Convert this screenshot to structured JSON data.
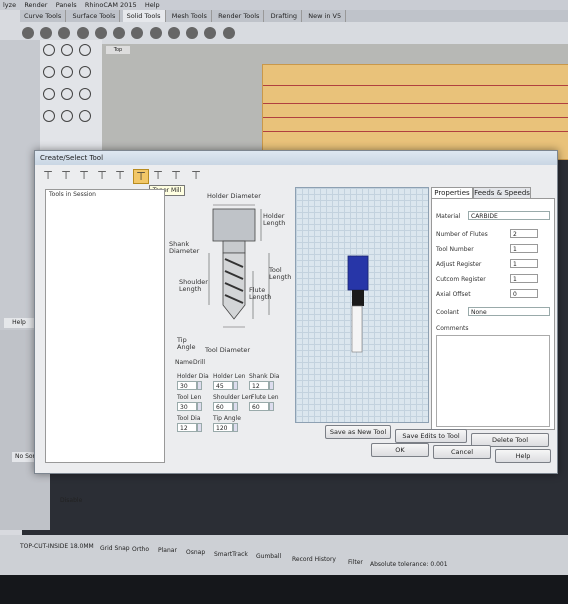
{
  "app": {
    "menu": [
      "lyze",
      "Render",
      "Panels",
      "RhinoCAM 2015",
      "Help"
    ],
    "tabs": [
      "Curve Tools",
      "Surface Tools",
      "Solid Tools",
      "Mesh Tools",
      "Render Tools",
      "Drafting",
      "New in V5"
    ],
    "active_tab": "Solid Tools",
    "help_label": "Help",
    "no_sort_label": "No Sort",
    "viewport_label": "Top"
  },
  "statusbar": {
    "layer": "TOP-CUT-INSIDE",
    "layer_value": "18.0MM",
    "grid_snap": "Grid Snap",
    "ortho": "Ortho",
    "planar": "Planar",
    "osnap": "Osnap",
    "smarttrack": "SmartTrack",
    "gumball": "Gumball",
    "record_history": "Record History",
    "filter": "Filter",
    "tolerance": "Absolute tolerance: 0.001",
    "disable": "Disable"
  },
  "dialog": {
    "title": "Create/Select Tool",
    "tooltip": "Taper Mill",
    "tools_in_session": "Tools in Session",
    "drawing": {
      "holder_diameter": "Holder Diameter",
      "holder_length": "Holder Length",
      "shank_diameter": "Shank Diameter",
      "tool_length": "Tool Length",
      "shoulder_length": "Shoulder Length",
      "flute_length": "Flute Length",
      "tip_angle": "Tip Angle",
      "tool_diameter": "Tool Diameter"
    },
    "name_label": "Name",
    "name_value": "Drill",
    "dims": {
      "holder_dia_label": "Holder Dia",
      "holder_dia": "30",
      "holder_len_label": "Holder Len",
      "holder_len": "45",
      "shank_dia_label": "Shank Dia",
      "shank_dia": "12",
      "tool_len_label": "Tool Len",
      "tool_len": "30",
      "shoulder_len_label": "Shoulder Len",
      "shoulder_len": "60",
      "flute_len_label": "Flute Len",
      "flute_len": "60",
      "tool_dia_label": "Tool Dia",
      "tool_dia": "12",
      "tip_angle_label": "Tip Angle",
      "tip_angle": "120"
    },
    "properties": {
      "tab_properties": "Properties",
      "tab_feeds": "Feeds & Speeds",
      "material_label": "Material",
      "material_value": "CARBIDE",
      "flutes_label": "Number of Flutes",
      "flutes_value": "2",
      "tool_number_label": "Tool Number",
      "tool_number_value": "1",
      "adjust_register_label": "Adjust Register",
      "adjust_register_value": "1",
      "cutcom_register_label": "Cutcom Register",
      "cutcom_register_value": "1",
      "axial_offset_label": "Axial Offset",
      "axial_offset_value": "0",
      "coolant_label": "Coolant",
      "coolant_value": "None",
      "comments_label": "Comments"
    },
    "buttons": {
      "save_new": "Save as New Tool",
      "save_edits": "Save Edits to Tool",
      "delete": "Delete Tool",
      "ok": "OK",
      "cancel": "Cancel",
      "help": "Help"
    }
  }
}
